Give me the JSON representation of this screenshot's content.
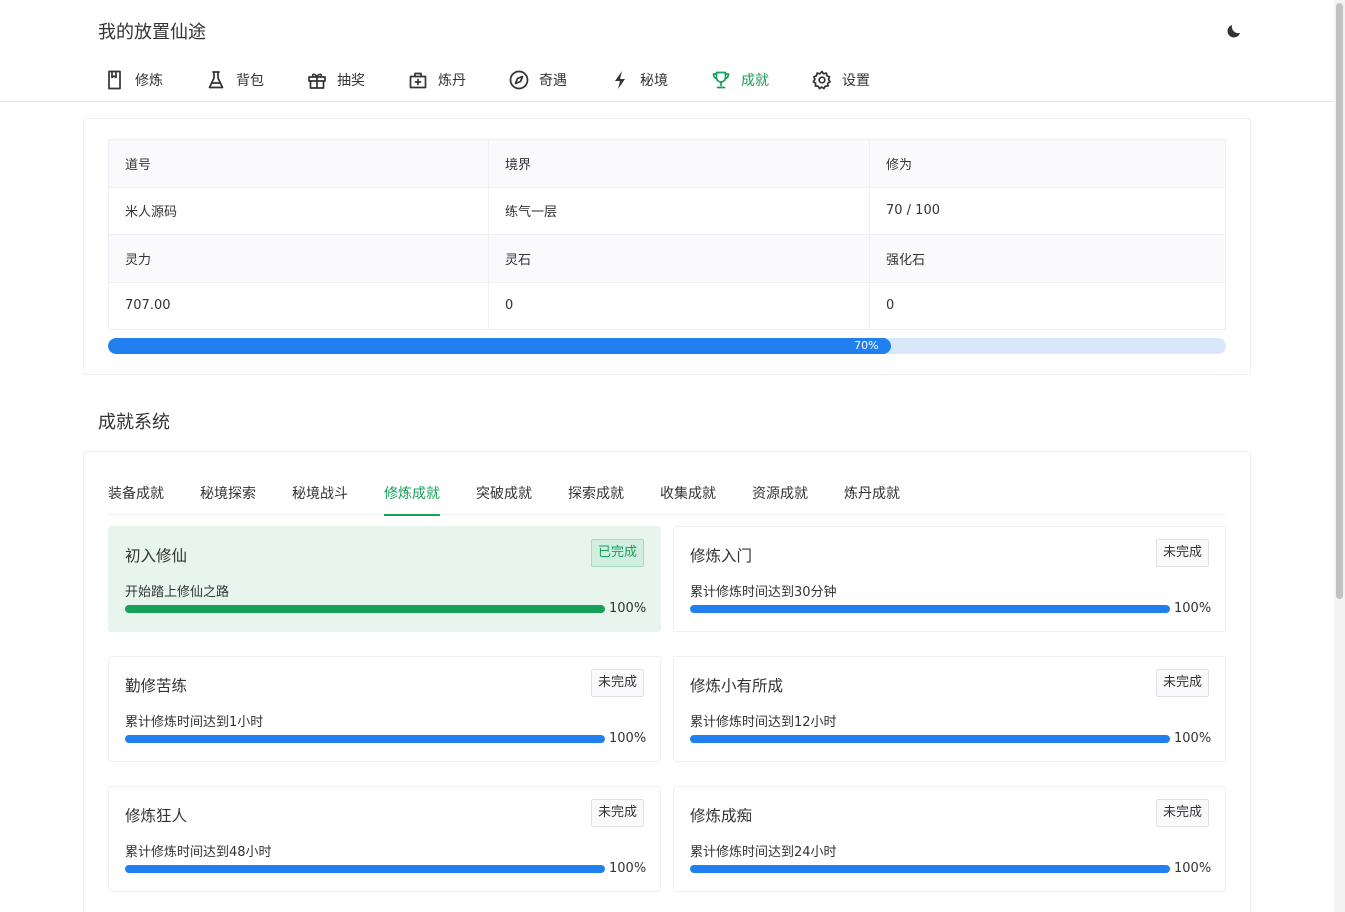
{
  "app": {
    "title": "我的放置仙途"
  },
  "icons": {
    "theme_toggle": "moon-icon"
  },
  "nav": [
    {
      "label": "修炼",
      "icon": "book-icon",
      "active": false
    },
    {
      "label": "背包",
      "icon": "flask-icon",
      "active": false
    },
    {
      "label": "抽奖",
      "icon": "gift-icon",
      "active": false
    },
    {
      "label": "炼丹",
      "icon": "medkit-icon",
      "active": false
    },
    {
      "label": "奇遇",
      "icon": "compass-icon",
      "active": false
    },
    {
      "label": "秘境",
      "icon": "lightning-icon",
      "active": false
    },
    {
      "label": "成就",
      "icon": "trophy-icon",
      "active": true
    },
    {
      "label": "设置",
      "icon": "gear-icon",
      "active": false
    }
  ],
  "stats": {
    "rows": [
      [
        "道号",
        "境界",
        "修为"
      ],
      [
        "米人源码",
        "练气一层",
        "70 / 100"
      ],
      [
        "灵力",
        "灵石",
        "强化石"
      ],
      [
        "707.00",
        "0",
        "0"
      ]
    ],
    "progress_percent": 70,
    "progress_label": "70%"
  },
  "achievements": {
    "title": "成就系统",
    "tabs": [
      {
        "label": "装备成就",
        "active": false
      },
      {
        "label": "秘境探索",
        "active": false
      },
      {
        "label": "秘境战斗",
        "active": false
      },
      {
        "label": "修炼成就",
        "active": true
      },
      {
        "label": "突破成就",
        "active": false
      },
      {
        "label": "探索成就",
        "active": false
      },
      {
        "label": "收集成就",
        "active": false
      },
      {
        "label": "资源成就",
        "active": false
      },
      {
        "label": "炼丹成就",
        "active": false
      }
    ],
    "items": [
      {
        "name": "初入修仙",
        "status": "已完成",
        "done": true,
        "desc": "开始踏上修仙之路",
        "percent": "100%"
      },
      {
        "name": "修炼入门",
        "status": "未完成",
        "done": false,
        "desc": "累计修炼时间达到30分钟",
        "percent": "100%"
      },
      {
        "name": "勤修苦练",
        "status": "未完成",
        "done": false,
        "desc": "累计修炼时间达到1小时",
        "percent": "100%"
      },
      {
        "name": "修炼小有所成",
        "status": "未完成",
        "done": false,
        "desc": "累计修炼时间达到12小时",
        "percent": "100%"
      },
      {
        "name": "修炼狂人",
        "status": "未完成",
        "done": false,
        "desc": "累计修炼时间达到48小时",
        "percent": "100%"
      },
      {
        "name": "修炼成痴",
        "status": "未完成",
        "done": false,
        "desc": "累计修炼时间达到24小时",
        "percent": "100%"
      }
    ]
  },
  "colors": {
    "accent": "#18a058",
    "progress": "#2080f0",
    "progress_track": "#d9e7fb"
  }
}
